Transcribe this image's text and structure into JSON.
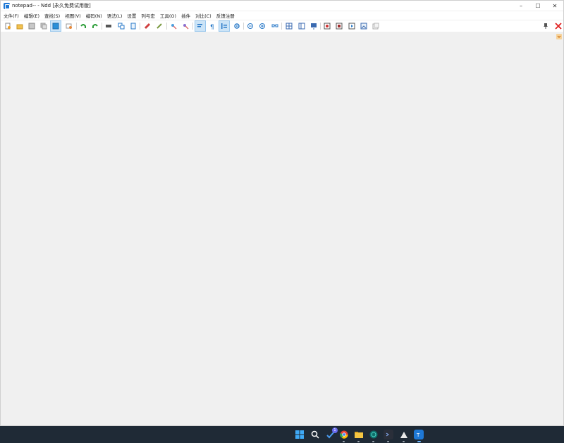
{
  "window": {
    "title": "notepad-- - Ndd [永久免费试用版]",
    "controls": {
      "minimize": "–",
      "maximize": "☐",
      "close": "✕"
    }
  },
  "menu": [
    "文件(F)",
    "编辑(E)",
    "查找(S)",
    "视图(V)",
    "编码(N)",
    "语法(L)",
    "设置",
    "列与宏",
    "工具(O)",
    "插件",
    "对比(C)",
    "反馈注册"
  ],
  "toolbar": {
    "icons": [
      "new-file-icon",
      "open-folder-icon",
      "save-icon",
      "save-all-icon",
      "close-file-icon",
      "close-all-icon",
      "undo-icon",
      "redo-icon",
      "cut-icon",
      "copy-icon",
      "paste-icon",
      "find-icon",
      "replace-icon",
      "mark-icon",
      "mark-clear-icon",
      "wrap-icon",
      "show-symbols-icon",
      "indent-guide-icon",
      "zoom-icon",
      "zoom-in-icon",
      "zoom-out-icon",
      "link-icon",
      "compare-dir-icon",
      "compare-file-icon",
      "monitor-icon",
      "record-macro-icon",
      "stop-macro-icon",
      "play-macro-icon",
      "image-icon",
      "batch-icon"
    ],
    "right": {
      "pin": "📌",
      "close": "✕"
    }
  },
  "colors": {
    "accent": "#1e78d6",
    "close_red": "#e02020",
    "active_bg": "#cce4f7",
    "taskbar": "#1f2a36"
  },
  "taskbar": {
    "icons": [
      "start-icon",
      "search-icon",
      "tasks-icon",
      "chrome-icon",
      "files-icon",
      "teal-app-icon",
      "terminal-icon",
      "store-icon",
      "notepad-icon"
    ],
    "badge": "1"
  }
}
